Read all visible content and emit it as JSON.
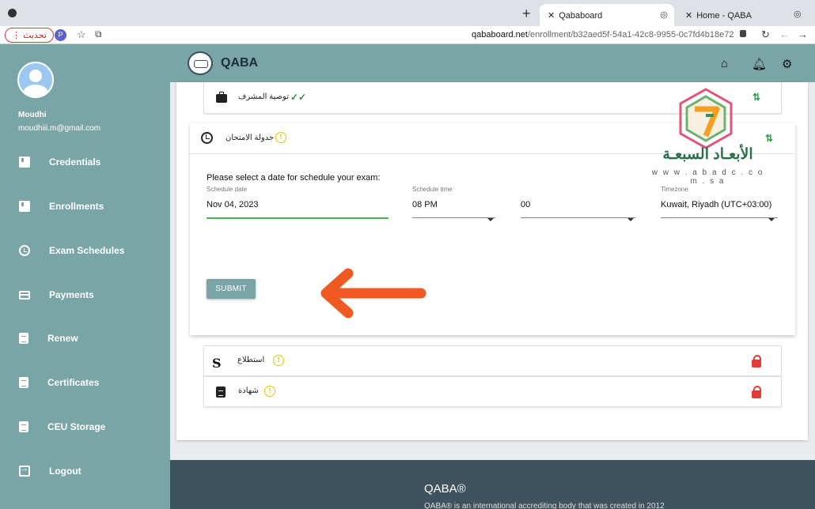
{
  "browser": {
    "tabs": [
      {
        "title": "Qababoard",
        "active": true
      },
      {
        "title": "Home - QABA",
        "active": false
      }
    ],
    "update_label": "تحديث",
    "profile_initial": "P",
    "url_host": "qababoard.net",
    "url_path": "/enrollment/b32aed5f-54a1-42c8-9955-0c7fd4b18e72"
  },
  "user": {
    "name": "Moudhi",
    "email": "moudhiii.m@gmail.com"
  },
  "sidebar": {
    "items": [
      {
        "label": "Credentials",
        "icon": "book-icon"
      },
      {
        "label": "Enrollments",
        "icon": "book-icon"
      },
      {
        "label": "Exam Schedules",
        "icon": "clock-icon"
      },
      {
        "label": "Payments",
        "icon": "credit-card-icon"
      },
      {
        "label": "Renew",
        "icon": "clipboard-icon"
      },
      {
        "label": "Certificates",
        "icon": "clipboard-icon"
      },
      {
        "label": "CEU Storage",
        "icon": "clipboard-icon"
      },
      {
        "label": "Logout",
        "icon": "logout-icon"
      }
    ]
  },
  "appbar": {
    "brand": "QABA",
    "icons": [
      "home-icon",
      "bell-icon",
      "gear-icon"
    ]
  },
  "steps": {
    "supervisor": {
      "label": "توصية المشرف",
      "status": "done"
    },
    "exam": {
      "label": "جدولة الامتحان",
      "status": "pending"
    },
    "survey": {
      "label": "استطلاع",
      "status": "locked"
    },
    "certificate": {
      "label": "شهادة",
      "status": "locked"
    }
  },
  "schedule": {
    "prompt": "Please select a date for schedule your exam:",
    "date_label": "Schedule date",
    "date_value": "Nov 04, 2023",
    "time_label": "Schedule time",
    "hour_value": "08 PM",
    "minute_value": "00",
    "timezone_label": "Timezone",
    "timezone_value": "Kuwait, Riyadh (UTC+03:00)",
    "submit_label": "SUBMIT"
  },
  "watermark": {
    "text": "الأبعـاد السبعـة",
    "url": "w w w . a b a d c . c o m . s a"
  },
  "footer": {
    "title": "QABA®",
    "text": "QABA® is an international accrediting body that was created in 2012"
  },
  "colors": {
    "sidebar": "#79a5a6",
    "footer": "#3f535e",
    "arrow": "#f05a22",
    "check": "#2e8b3a",
    "warn": "#e6c300",
    "lock": "#e53935"
  }
}
